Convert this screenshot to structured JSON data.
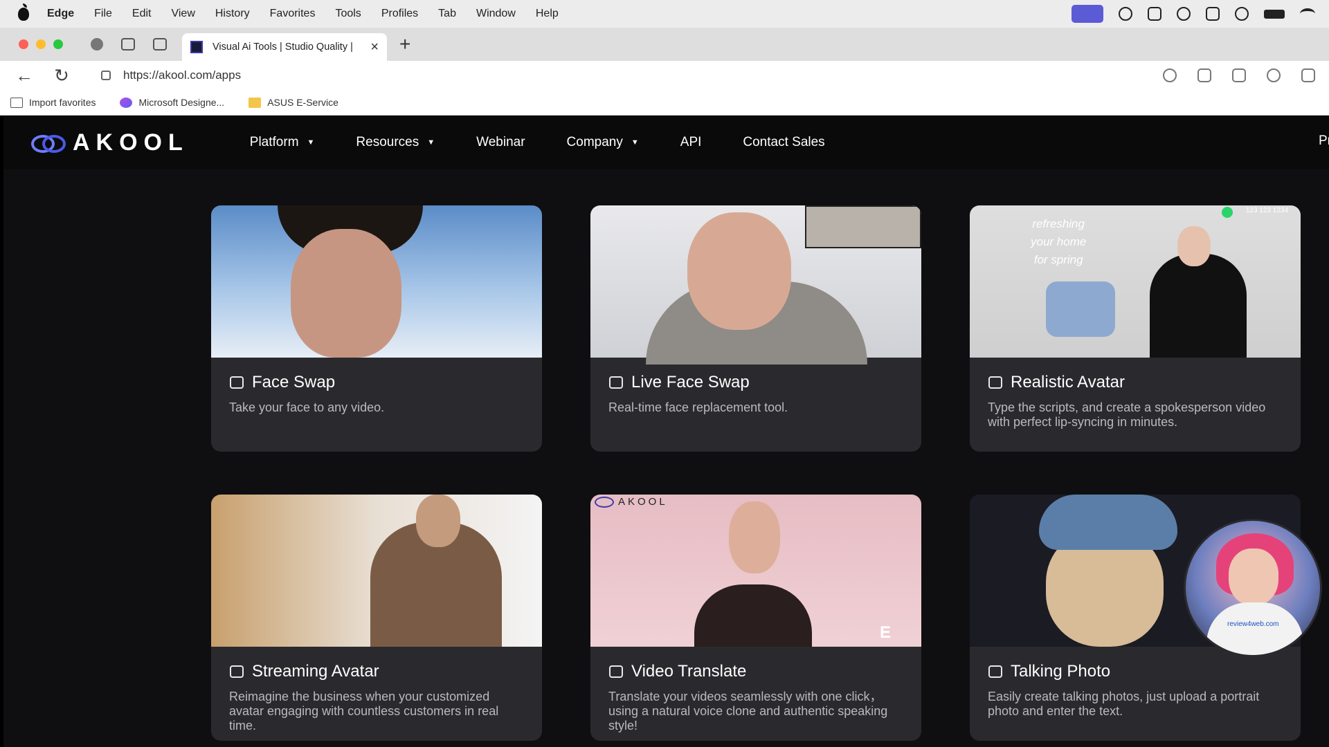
{
  "mac_menubar": {
    "app_name": "Edge",
    "items": [
      "File",
      "Edit",
      "View",
      "History",
      "Favorites",
      "Tools",
      "Profiles",
      "Tab",
      "Window",
      "Help"
    ]
  },
  "browser": {
    "tab_title": "Visual Ai Tools | Studio Quality |",
    "url": "https://akool.com/apps",
    "bookmarks": [
      "Import favorites",
      "Microsoft Designe...",
      "ASUS E-Service"
    ]
  },
  "site": {
    "logo_text": "AKOOL",
    "nav": [
      "Platform",
      "Resources",
      "Webinar",
      "Company",
      "API",
      "Contact Sales"
    ],
    "nav_cut": "Pr"
  },
  "cards": [
    {
      "title": "Face Swap",
      "desc": "Take your face to any video.",
      "icon": "face-swap-icon"
    },
    {
      "title": "Live Face Swap",
      "desc": "Real-time face replacement tool.",
      "icon": "live-face-swap-icon"
    },
    {
      "title": "Realistic Avatar",
      "desc": "Type the scripts, and create a spokesperson video with perfect lip-syncing in minutes.",
      "icon": "avatar-icon"
    },
    {
      "title": "Streaming Avatar",
      "desc": "Reimagine the business when your customized avatar engaging with countless customers in real time.",
      "icon": "streaming-avatar-icon"
    },
    {
      "title": "Video Translate",
      "desc": "Translate your videos seamlessly with one click，using a natural voice clone and authentic speaking style!",
      "icon": "translate-icon"
    },
    {
      "title": "Talking Photo",
      "desc": "Easily create talking photos, just upload a portrait photo and enter the text.",
      "icon": "talking-photo-icon"
    }
  ],
  "image_overlays": {
    "avatar_text": [
      "refreshing",
      "your home",
      "for spring"
    ],
    "avatar_phone": "123 123 1234",
    "translate_watermark": "AKOOL",
    "translate_corner_logo": "E",
    "webcam_shirt_text": "review4web.com"
  },
  "colors": {
    "page_bg": "#0f0f11",
    "card_bg": "#2a2a2e",
    "brand": "#6e7dfb"
  }
}
